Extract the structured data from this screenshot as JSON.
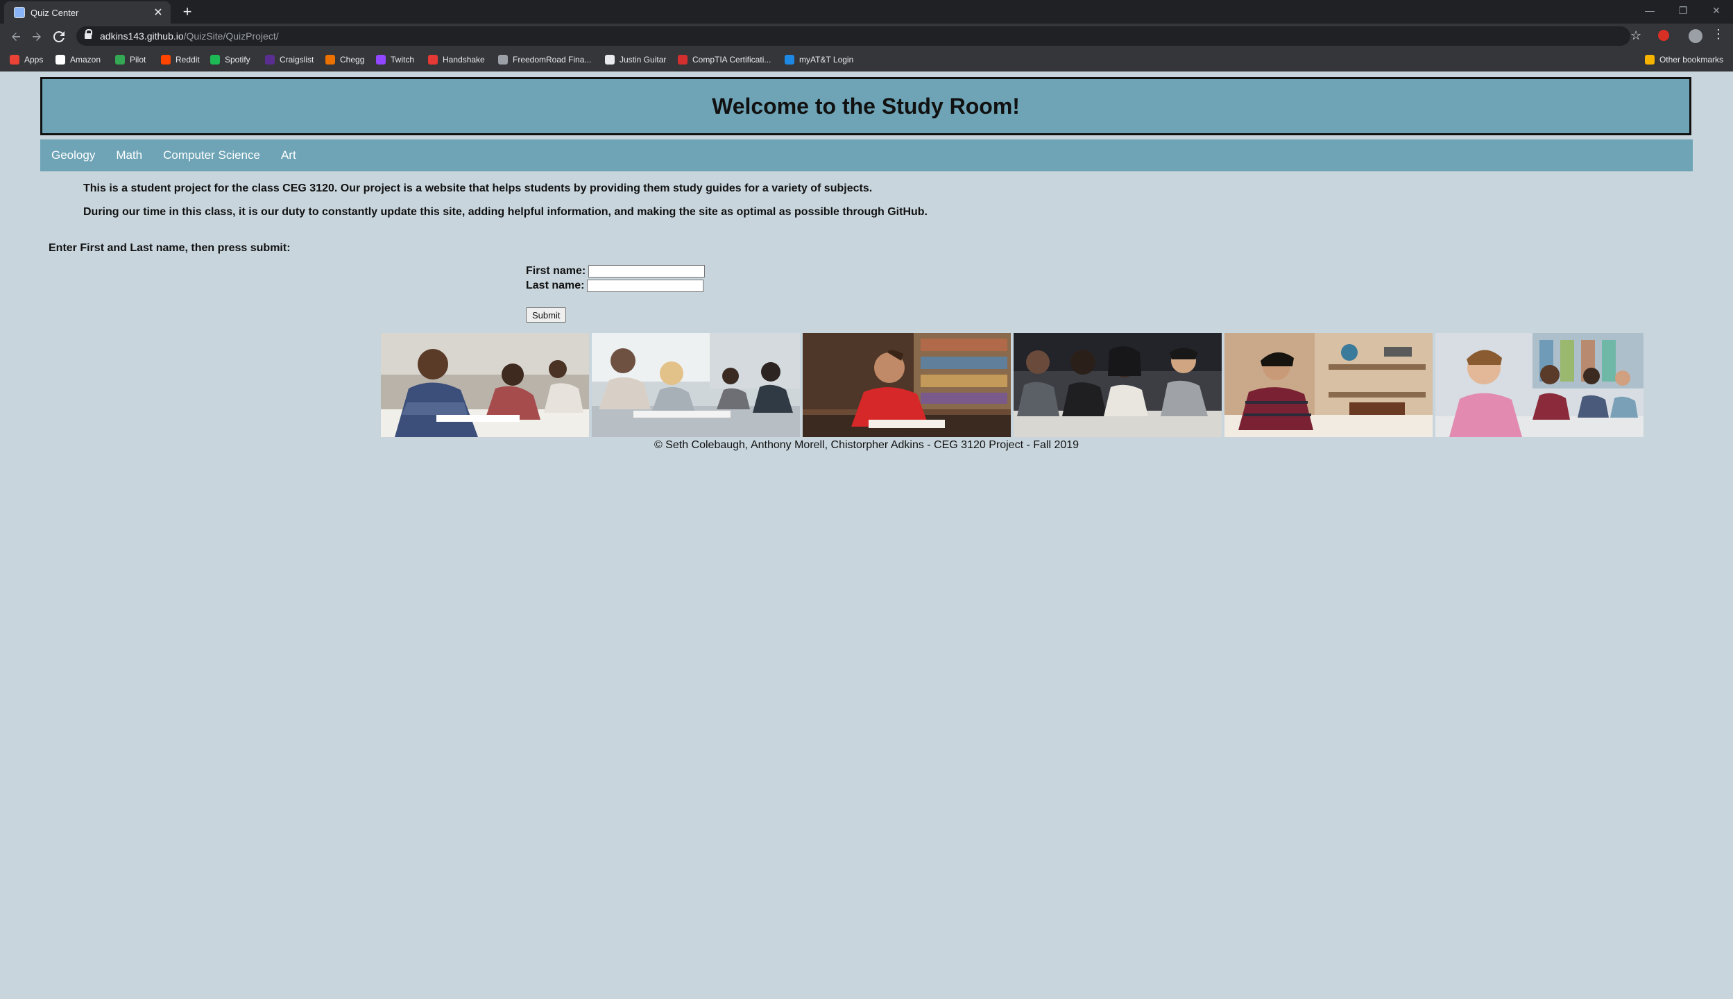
{
  "browser": {
    "tab_title": "Quiz Center",
    "tab_close": "✕",
    "new_tab": "+",
    "url_host": "adkins143.github.io",
    "url_path": "/QuizSite/QuizProject/",
    "window_controls": [
      "—",
      "❐",
      "✕"
    ],
    "bookmarks": [
      {
        "label": "Apps",
        "color": "#ea4335"
      },
      {
        "label": "Amazon",
        "color": "#ffffff"
      },
      {
        "label": "Pilot",
        "color": "#34a853"
      },
      {
        "label": "Reddit",
        "color": "#ff4500"
      },
      {
        "label": "Spotify",
        "color": "#1db954"
      },
      {
        "label": "Craigslist",
        "color": "#5a2d91"
      },
      {
        "label": "Chegg",
        "color": "#eb7100"
      },
      {
        "label": "Twitch",
        "color": "#9146ff"
      },
      {
        "label": "Handshake",
        "color": "#e53935"
      },
      {
        "label": "FreedomRoad Fina...",
        "color": "#9aa0a6"
      },
      {
        "label": "Justin Guitar",
        "color": "#e8eaed"
      },
      {
        "label": "CompTIA Certificati...",
        "color": "#d32f2f"
      },
      {
        "label": "myAT&T Login",
        "color": "#1e88e5"
      }
    ],
    "other_bookmarks": "Other bookmarks"
  },
  "page": {
    "title": "Welcome to the Study Room!",
    "nav": [
      "Geology",
      "Math",
      "Computer Science",
      "Art"
    ],
    "intro_1": "This is a student project for the class CEG 3120. Our project is a website that helps students by providing them study guides for a variety of subjects.",
    "intro_2": "During our time in this class, it is our duty to constantly update this site, adding helpful information, and making the site as optimal as possible through GitHub.",
    "enter_label": "Enter First and Last name, then press submit:",
    "first_name_label": "First name:",
    "last_name_label": "Last name:",
    "first_name_value": "",
    "last_name_value": "",
    "submit_label": "Submit",
    "footer": "© Seth Colebaugh, Anthony Morell, Chistorpher Adkins - CEG 3120 Project - Fall 2019"
  },
  "colors": {
    "header_bg": "#6ea4b6",
    "page_bg": "#c8d5dc"
  }
}
